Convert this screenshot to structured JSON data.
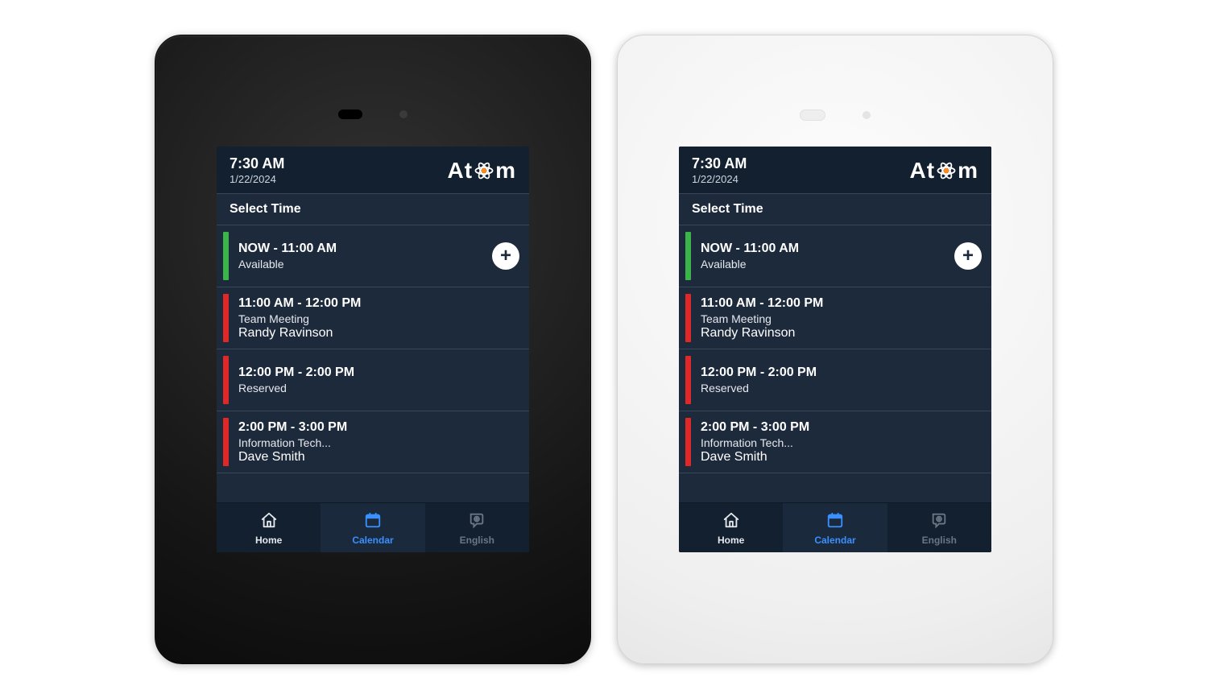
{
  "header": {
    "time": "7:30 AM",
    "date": "1/22/2024",
    "logo_left": "At",
    "logo_right": "m"
  },
  "section_title": "Select Time",
  "slots": [
    {
      "time": "NOW - 11:00 AM",
      "sub": "Available",
      "person": "",
      "status": "green",
      "addable": true
    },
    {
      "time": "11:00 AM - 12:00 PM",
      "sub": "Team Meeting",
      "person": "Randy Ravinson",
      "status": "red",
      "addable": false
    },
    {
      "time": "12:00 PM - 2:00 PM",
      "sub": "Reserved",
      "person": "",
      "status": "red",
      "addable": false
    },
    {
      "time": "2:00 PM - 3:00 PM",
      "sub": "Information Tech...",
      "person": "Dave Smith",
      "status": "red",
      "addable": false
    }
  ],
  "nav": {
    "home": "Home",
    "calendar": "Calendar",
    "english": "English"
  }
}
